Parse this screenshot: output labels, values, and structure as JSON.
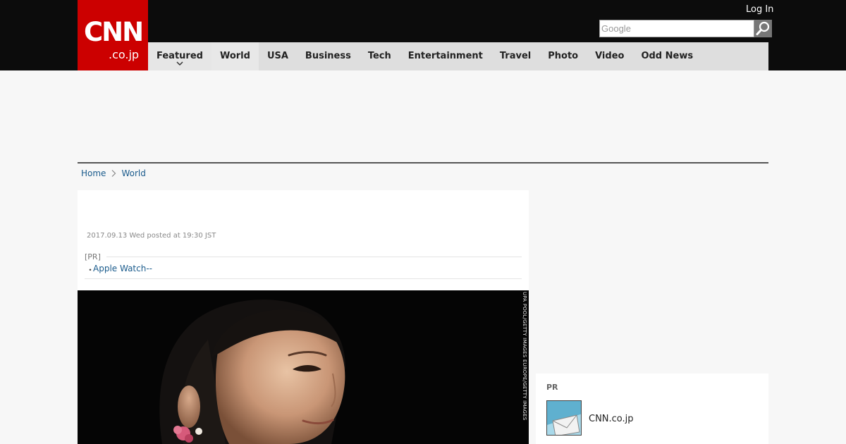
{
  "header": {
    "logo_main": "CNN",
    "logo_sub": ".co.jp",
    "login_label": "Log In",
    "search": {
      "placeholder": "Google"
    }
  },
  "nav": {
    "items": [
      {
        "label": "Featured"
      },
      {
        "label": "World"
      },
      {
        "label": "USA"
      },
      {
        "label": "Business"
      },
      {
        "label": "Tech"
      },
      {
        "label": "Entertainment"
      },
      {
        "label": "Travel"
      },
      {
        "label": "Photo"
      },
      {
        "label": "Video"
      },
      {
        "label": "Odd News"
      }
    ],
    "active": "World"
  },
  "breadcrumb": {
    "home": "Home",
    "section": "World"
  },
  "article": {
    "timestamp": "2017.09.13 Wed posted at 19:30 JST",
    "pr_label": "[PR]",
    "pr_bullet": "・",
    "pr_link": "Apple Watch--",
    "photo_credit": "UPA POOL/GETTY IMAGES EUROPE/GETTY IMAGES"
  },
  "sidebar": {
    "pr_label": "PR",
    "link_label": "CNN.co.jp"
  },
  "colors": {
    "brand_red": "#cc0000",
    "topbar": "#0c0c0c",
    "link_blue": "#1a5b8c",
    "nav_bg": "#dedede"
  }
}
